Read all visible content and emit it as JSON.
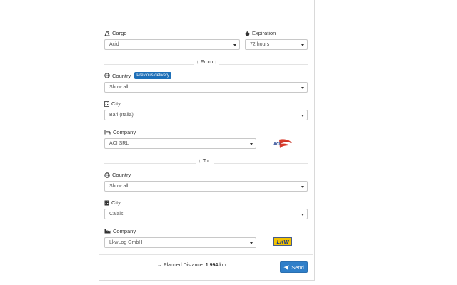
{
  "cargo": {
    "label": "Cargo",
    "value": "Acid"
  },
  "expiration": {
    "label": "Expiration",
    "value": "72 hours"
  },
  "from": {
    "header": "From",
    "country_label": "Country",
    "previous_delivery": "Previous delivery",
    "country_value": "Show all",
    "city_label": "City",
    "city_value": "Bari (Italia)",
    "company_label": "Company",
    "company_value": "ACI SRL",
    "company_logo_text": "ACI"
  },
  "to": {
    "header": "To",
    "country_label": "Country",
    "country_value": "Show all",
    "city_label": "City",
    "city_value": "Calais",
    "company_label": "Company",
    "company_value": "LkwLog GmbH",
    "company_logo_text": "LKW"
  },
  "footer": {
    "distance_label": "Planned Distance:",
    "distance_value": "1 994",
    "distance_unit": "km",
    "send_label": "Send"
  },
  "colors": {
    "accent": "#2f7fc9",
    "badge": "#1d6fb8",
    "aci_red": "#d83a2b",
    "lkw_yellow": "#f2c200",
    "lkw_blue": "#1a3a8a"
  }
}
